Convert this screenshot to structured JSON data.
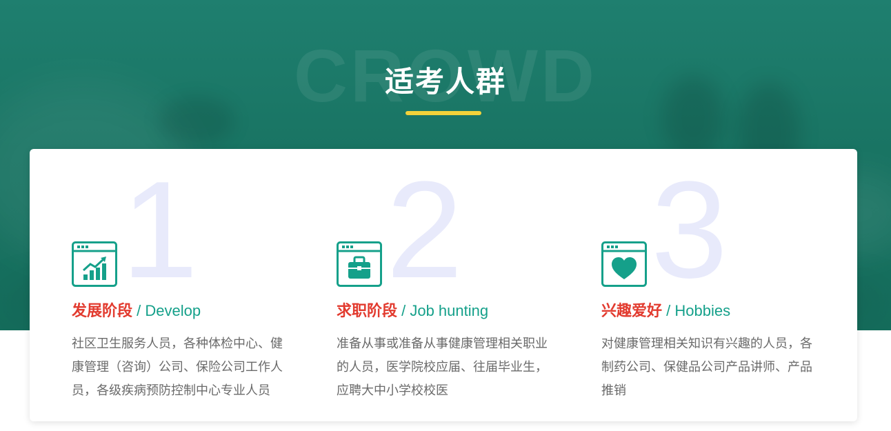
{
  "section": {
    "watermark": "CROWD",
    "title": "适考人群"
  },
  "colors": {
    "primary_green": "#15a08a",
    "accent_red": "#e23b2f",
    "underline_yellow": "#f3d23a",
    "number_lavender": "#e8eafb"
  },
  "cards": [
    {
      "number": "1",
      "icon": "growth-chart-icon",
      "title_zh": "发展阶段",
      "title_en": " / Develop",
      "description": "社区卫生服务人员，各种体检中心、健康管理（咨询）公司、保险公司工作人员，各级疾病预防控制中心专业人员"
    },
    {
      "number": "2",
      "icon": "briefcase-icon",
      "title_zh": "求职阶段",
      "title_en": " / Job hunting",
      "description": "准备从事或准备从事健康管理相关职业的人员，医学院校应届、往届毕业生，应聘大中小学校校医"
    },
    {
      "number": "3",
      "icon": "heart-icon",
      "title_zh": "兴趣爱好",
      "title_en": " / Hobbies",
      "description": "对健康管理相关知识有兴趣的人员，各制药公司、保健品公司产品讲师、产品推销"
    }
  ]
}
